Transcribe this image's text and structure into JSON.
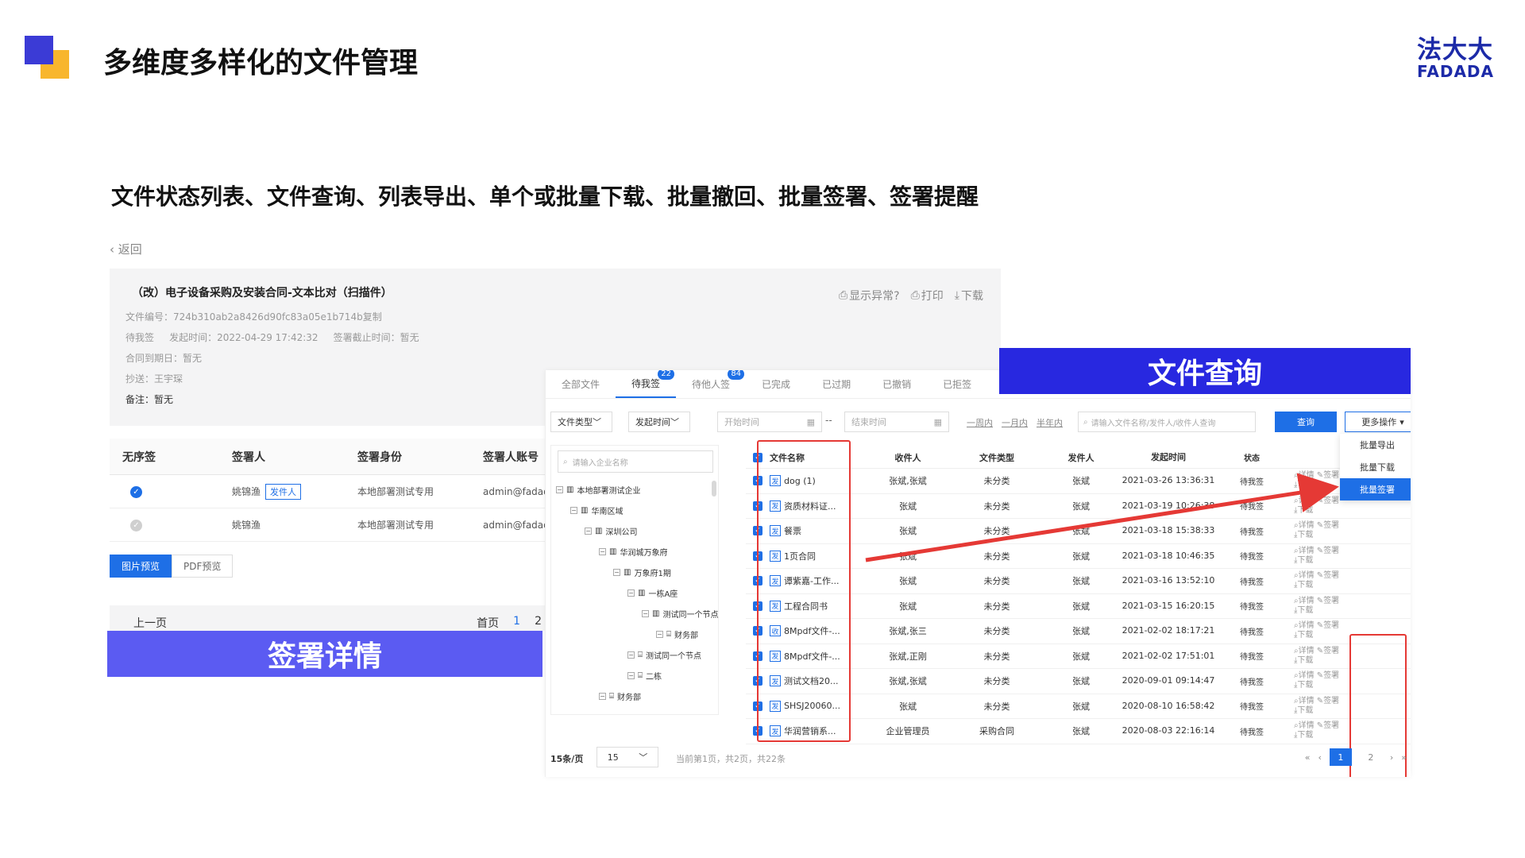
{
  "slide": {
    "title": "多维度多样化的文件管理",
    "subtitle": "文件状态列表、文件查询、列表导出、单个或批量下载、批量撤回、批量签署、签署提醒",
    "logo_cn": "法大大",
    "logo_en": "FADADA",
    "brand_colors": {
      "blue": "#3b3bd6",
      "yellow": "#f8b62d",
      "accent": "#1e6fe6"
    }
  },
  "detail": {
    "back": "返回",
    "title": "（改）电子设备采购及安装合同-文本比对（扫描件）",
    "file_no_label": "文件编号：",
    "file_no": "724b310ab2a8426d90fc83a05e1b714b复制",
    "status": "待我签",
    "send_time_label": "发起时间：",
    "send_time": "2022-04-29 17:42:32",
    "deadline_label": "签署截止时间：",
    "deadline": "暂无",
    "expire_label": "合同到期日：",
    "expire": "暂无",
    "cc_label": "抄送：",
    "cc": "王宇琛",
    "remark_label": "备注：",
    "remark": "暂无",
    "actions": [
      "显示异常?",
      "打印",
      "下载"
    ],
    "table_headers": [
      "无序签",
      "签署人",
      "签署身份",
      "签署人账号"
    ],
    "rows": [
      {
        "name": "姚锦渔",
        "role_tag": "发件人",
        "identity": "本地部署测试专用",
        "account": "admin@fadada.com",
        "checked": true
      },
      {
        "name": "姚锦渔",
        "role_tag": "",
        "identity": "本地部署测试专用",
        "account": "admin@fadada.com",
        "checked": false
      }
    ],
    "preview_tabs": [
      "图片预览",
      "PDF预览"
    ],
    "pager": {
      "prev": "上一页",
      "first": "首页",
      "pages": [
        "1",
        "2"
      ]
    },
    "banner": "签署详情"
  },
  "list": {
    "banner": "文件查询",
    "tabs": [
      {
        "label": "全部文件",
        "badge": ""
      },
      {
        "label": "待我签",
        "badge": "22"
      },
      {
        "label": "待他人签",
        "badge": "84"
      },
      {
        "label": "已完成",
        "badge": ""
      },
      {
        "label": "已过期",
        "badge": ""
      },
      {
        "label": "已撤销",
        "badge": ""
      },
      {
        "label": "已拒签",
        "badge": ""
      }
    ],
    "filters": {
      "file_type": "文件类型",
      "send_time": "发起时间",
      "start_placeholder": "开始时间",
      "end_placeholder": "结束时间",
      "quick": [
        "一周内",
        "一月内",
        "半年内"
      ],
      "search_placeholder": "请输入文件名称/发件人/收件人查询",
      "query_btn": "查询",
      "more_btn": "更多操作"
    },
    "more_menu": [
      "批量导出",
      "批量下载",
      "批量签署"
    ],
    "tree": {
      "search_placeholder": "请输入企业名称",
      "nodes": [
        "本地部署测试企业",
        "华南区域",
        "深圳公司",
        "华润城万象府",
        "万象府1期",
        "一栋A座",
        "测试同一个节点",
        "财务部",
        "测试同一个节点",
        "二栋",
        "财务部"
      ]
    },
    "headers": [
      "文件名称",
      "收件人",
      "文件类型",
      "发件人",
      "发起时间",
      "状态"
    ],
    "rows": [
      {
        "tag": "发",
        "name": "dog (1)",
        "recipient": "张斌,张斌",
        "type": "未分类",
        "sender": "张斌",
        "time": "2021-03-26 13:36:31",
        "status": "待我签"
      },
      {
        "tag": "发",
        "name": "资质材料证...",
        "recipient": "张斌",
        "type": "未分类",
        "sender": "张斌",
        "time": "2021-03-19 10:26:38",
        "status": "待我签"
      },
      {
        "tag": "发",
        "name": "餐票",
        "recipient": "张斌",
        "type": "未分类",
        "sender": "张斌",
        "time": "2021-03-18 15:38:33",
        "status": "待我签"
      },
      {
        "tag": "发",
        "name": "1页合同",
        "recipient": "张斌",
        "type": "未分类",
        "sender": "张斌",
        "time": "2021-03-18 10:46:35",
        "status": "待我签"
      },
      {
        "tag": "发",
        "name": "谭紫嘉-工作...",
        "recipient": "张斌",
        "type": "未分类",
        "sender": "张斌",
        "time": "2021-03-16 13:52:10",
        "status": "待我签"
      },
      {
        "tag": "发",
        "name": "工程合同书",
        "recipient": "张斌",
        "type": "未分类",
        "sender": "张斌",
        "time": "2021-03-15 16:20:15",
        "status": "待我签"
      },
      {
        "tag": "收",
        "name": "8Mpdf文件-...",
        "recipient": "张斌,张三",
        "type": "未分类",
        "sender": "张斌",
        "time": "2021-02-02 18:17:21",
        "status": "待我签"
      },
      {
        "tag": "发",
        "name": "8Mpdf文件-...",
        "recipient": "张斌,正刚",
        "type": "未分类",
        "sender": "张斌",
        "time": "2021-02-02 17:51:01",
        "status": "待我签"
      },
      {
        "tag": "发",
        "name": "测试文档20...",
        "recipient": "张斌,张斌",
        "type": "未分类",
        "sender": "张斌",
        "time": "2020-09-01 09:14:47",
        "status": "待我签"
      },
      {
        "tag": "发",
        "name": "SHSJ20060...",
        "recipient": "张斌",
        "type": "未分类",
        "sender": "张斌",
        "time": "2020-08-10 16:58:42",
        "status": "待我签"
      },
      {
        "tag": "发",
        "name": "华润营销系...",
        "recipient": "企业管理员",
        "type": "采购合同",
        "sender": "张斌",
        "time": "2020-08-03 22:16:14",
        "status": "待我签"
      }
    ],
    "row_actions": {
      "detail": "详情",
      "sign": "签署",
      "download": "下载"
    },
    "footer": {
      "per_page_label": "15条/页",
      "per_page": "15",
      "info": "当前第1页，共2页，共22条",
      "pages": [
        "1",
        "2"
      ]
    }
  }
}
